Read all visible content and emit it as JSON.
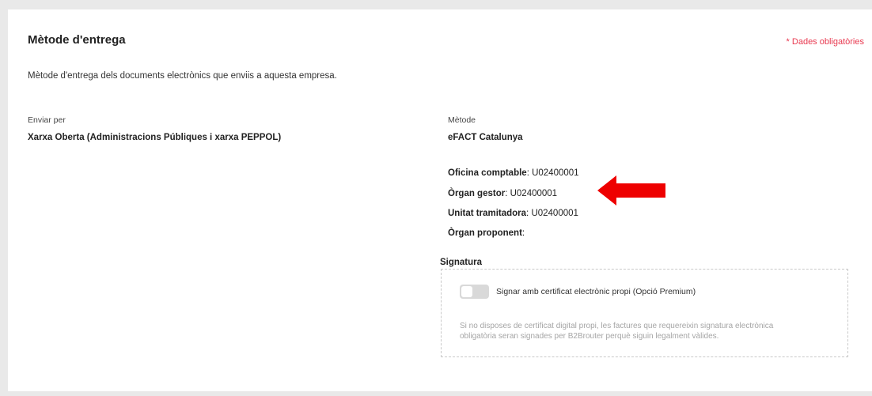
{
  "section": {
    "title": "Mètode d'entrega",
    "required_note": "* Dades obligatòries",
    "description": "Mètode d'entrega dels documents electrònics que enviis a aquesta empresa."
  },
  "send_by": {
    "label": "Enviar per",
    "value": "Xarxa Oberta (Administracions Públiques i xarxa PEPPOL)"
  },
  "method": {
    "label": "Mètode",
    "value": "eFACT Catalunya"
  },
  "fields": [
    {
      "label": "Oficina comptable",
      "value": "U02400001"
    },
    {
      "label": "Òrgan gestor",
      "value": "U02400001"
    },
    {
      "label": "Unitat tramitadora",
      "value": "U02400001"
    },
    {
      "label": "Òrgan proponent",
      "value": ""
    }
  ],
  "signature": {
    "legend": "Signatura",
    "toggle_label": "Signar amb certificat electrònic propi (Opció Premium)",
    "toggle_on": false,
    "hint": "Si no disposes de certificat digital propi, les factures que requereixin signatura electrònica obligatòria seran signades per B2Brouter perquè siguin legalment vàlides."
  },
  "annotation": {
    "arrow_color": "#ee0000"
  }
}
